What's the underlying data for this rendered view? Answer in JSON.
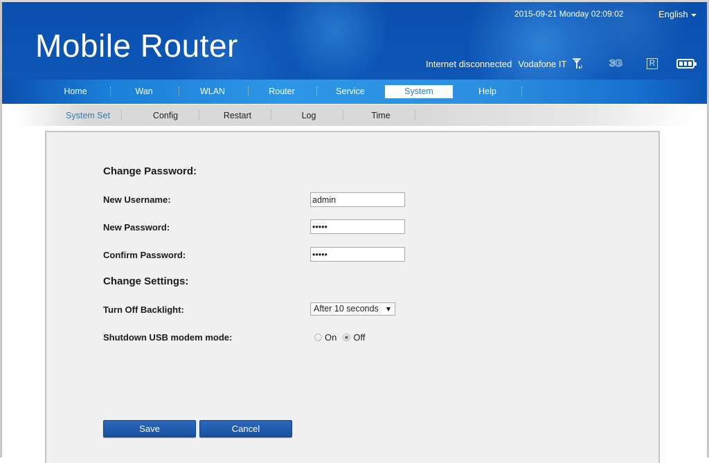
{
  "header": {
    "title": "Mobile Router",
    "datetime": "2015-09-21 Monday 02:09:02",
    "language": "English",
    "connection_status": "Internet disconnected",
    "carrier": "Vodafone IT",
    "network_type": "3G",
    "roaming_indicator": "R",
    "icons": [
      "signal-icon",
      "3g-icon",
      "roaming-icon",
      "battery-icon"
    ],
    "battery_level_bars": 3
  },
  "nav": {
    "items": [
      {
        "label": "Home"
      },
      {
        "label": "Wan"
      },
      {
        "label": "WLAN"
      },
      {
        "label": "Router"
      },
      {
        "label": "Service"
      },
      {
        "label": "System",
        "active": true
      },
      {
        "label": "Help"
      }
    ]
  },
  "subnav": {
    "items": [
      {
        "label": "System Set",
        "active": true
      },
      {
        "label": "Config"
      },
      {
        "label": "Restart"
      },
      {
        "label": "Log"
      },
      {
        "label": "Time"
      }
    ]
  },
  "form": {
    "change_password_title": "Change Password:",
    "username_label": "New Username:",
    "username_value": "admin",
    "password_label": "New Password:",
    "password_value": "•••••",
    "confirm_label": "Confirm Password:",
    "confirm_value": "•••••",
    "change_settings_title": "Change Settings:",
    "backlight_label": "Turn Off Backlight:",
    "backlight_value": "After 10 seconds",
    "usb_label": "Shutdown USB modem mode:",
    "usb_options": [
      {
        "label": "On",
        "checked": false
      },
      {
        "label": "Off",
        "checked": true
      }
    ],
    "save_label": "Save",
    "cancel_label": "Cancel"
  },
  "colors": {
    "header_blue": "#0d56b6",
    "nav_blue": "#2d96e6",
    "active_sub": "#3b78b0",
    "button_blue": "#1a4f9f"
  }
}
